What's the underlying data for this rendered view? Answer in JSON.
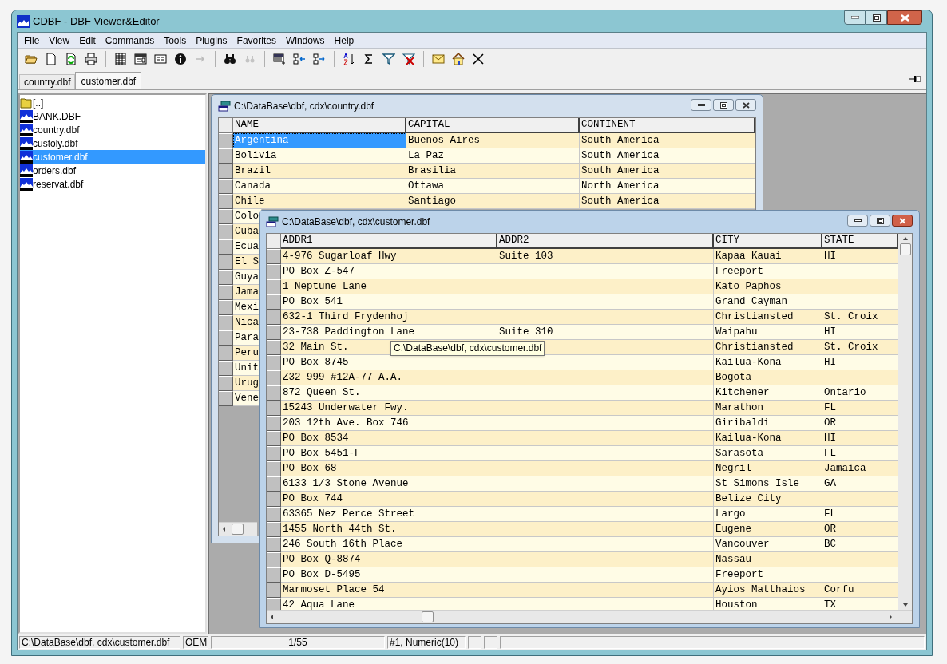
{
  "window": {
    "title": "CDBF - DBF Viewer&Editor"
  },
  "menu": [
    "File",
    "View",
    "Edit",
    "Commands",
    "Tools",
    "Plugins",
    "Favorites",
    "Windows",
    "Help"
  ],
  "toolbar": [
    {
      "disabled": false
    },
    {
      "disabled": false
    },
    {
      "disabled": false
    },
    {
      "disabled": false
    },
    {
      "disabled": false
    },
    {
      "disabled": false
    },
    {
      "disabled": false
    },
    {
      "disabled": false
    },
    {
      "disabled": true
    },
    {
      "disabled": false
    },
    {
      "disabled": true
    },
    {
      "disabled": false
    },
    {
      "disabled": false
    },
    {
      "disabled": false
    },
    {
      "disabled": false
    },
    {
      "disabled": false
    },
    {
      "disabled": false
    },
    {
      "disabled": false
    },
    {
      "disabled": false
    },
    {
      "disabled": false
    },
    {
      "disabled": false
    }
  ],
  "tabs": [
    {
      "label": "country.dbf",
      "selected": false
    },
    {
      "label": "customer.dbf",
      "selected": true
    }
  ],
  "files": [
    {
      "kind": "folder",
      "label": "[..]",
      "selected": false
    },
    {
      "kind": "dbf",
      "label": "BANK.DBF",
      "selected": false
    },
    {
      "kind": "dbf",
      "label": "country.dbf",
      "selected": false
    },
    {
      "kind": "dbf",
      "label": "custoly.dbf",
      "selected": false
    },
    {
      "kind": "dbf",
      "label": "customer.dbf",
      "selected": true
    },
    {
      "kind": "dbf",
      "label": "orders.dbf",
      "selected": false
    },
    {
      "kind": "dbf",
      "label": "reservat.dbf",
      "selected": false
    }
  ],
  "country_window": {
    "title": "C:\\DataBase\\dbf, cdx\\country.dbf",
    "active": false,
    "columns": [
      "NAME",
      "CAPITAL",
      "CONTINENT"
    ],
    "rows": [
      {
        "cells": [
          "Argentina",
          "Buenos Aires",
          "South America"
        ],
        "selected": true
      },
      {
        "cells": [
          "Bolivia",
          "La Paz",
          "South America"
        ],
        "selected": false
      },
      {
        "cells": [
          "Brazil",
          "Brasilia",
          "South America"
        ],
        "selected": false
      },
      {
        "cells": [
          "Canada",
          "Ottawa",
          "North America"
        ],
        "selected": false
      },
      {
        "cells": [
          "Chile",
          "Santiago",
          "South America"
        ],
        "selected": false
      },
      {
        "cells": [
          "Colo"
        ],
        "selected": false
      },
      {
        "cells": [
          "Cuba"
        ],
        "selected": false
      },
      {
        "cells": [
          "Ecua"
        ],
        "selected": false
      },
      {
        "cells": [
          "El S"
        ],
        "selected": false
      },
      {
        "cells": [
          "Guya"
        ],
        "selected": false
      },
      {
        "cells": [
          "Jama"
        ],
        "selected": false
      },
      {
        "cells": [
          "Mexi"
        ],
        "selected": false
      },
      {
        "cells": [
          "Nica"
        ],
        "selected": false
      },
      {
        "cells": [
          "Para"
        ],
        "selected": false
      },
      {
        "cells": [
          "Peru"
        ],
        "selected": false
      },
      {
        "cells": [
          "Unit"
        ],
        "selected": false
      },
      {
        "cells": [
          "Urug"
        ],
        "selected": false
      },
      {
        "cells": [
          "Vene"
        ],
        "selected": false
      }
    ]
  },
  "customer_window": {
    "title": "C:\\DataBase\\dbf, cdx\\customer.dbf",
    "active": true,
    "columns": [
      "ADDR1",
      "ADDR2",
      "CITY",
      "STATE"
    ],
    "rows": [
      [
        "4-976 Sugarloaf Hwy",
        "Suite 103",
        "Kapaa Kauai",
        "HI"
      ],
      [
        "PO Box Z-547",
        "",
        "Freeport",
        ""
      ],
      [
        "1 Neptune Lane",
        "",
        "Kato Paphos",
        ""
      ],
      [
        "PO Box 541",
        "",
        "Grand Cayman",
        ""
      ],
      [
        "632-1 Third Frydenhoj",
        "",
        "Christiansted",
        "St. Croix"
      ],
      [
        "23-738 Paddington Lane",
        "Suite 310",
        "Waipahu",
        "HI"
      ],
      [
        "32 Main St.",
        "",
        "Christiansted",
        "St. Croix"
      ],
      [
        "PO Box 8745",
        "",
        "Kailua-Kona",
        "HI"
      ],
      [
        "Z32 999 #12A-77 A.A.",
        "",
        "Bogota",
        ""
      ],
      [
        "872 Queen St.",
        "",
        "Kitchener",
        "Ontario"
      ],
      [
        "15243 Underwater Fwy.",
        "",
        "Marathon",
        "FL"
      ],
      [
        "203 12th Ave. Box 746",
        "",
        "Giribaldi",
        "OR"
      ],
      [
        "PO Box 8534",
        "",
        "Kailua-Kona",
        "HI"
      ],
      [
        "PO Box 5451-F",
        "",
        "Sarasota",
        "FL"
      ],
      [
        "PO Box 68",
        "",
        "Negril",
        "Jamaica"
      ],
      [
        "6133 1/3 Stone Avenue",
        "",
        "St Simons Isle",
        "GA"
      ],
      [
        "PO Box 744",
        "",
        "Belize City",
        ""
      ],
      [
        "63365 Nez Perce Street",
        "",
        "Largo",
        "FL"
      ],
      [
        "1455 North 44th St.",
        "",
        "Eugene",
        "OR"
      ],
      [
        "246 South 16th Place",
        "",
        "Vancouver",
        "BC"
      ],
      [
        "PO Box Q-8874",
        "",
        "Nassau",
        ""
      ],
      [
        "PO Box D-5495",
        "",
        "Freeport",
        ""
      ],
      [
        "Marmoset Place 54",
        "",
        "Ayios Matthaios",
        "Corfu"
      ],
      [
        "42 Aqua Lane",
        "",
        "Houston",
        "TX"
      ]
    ]
  },
  "tooltip": "C:\\DataBase\\dbf, cdx\\customer.dbf",
  "status_bar": [
    "C:\\DataBase\\dbf, cdx\\customer.dbf",
    "OEM",
    "1/55",
    "#1, Numeric(10)"
  ]
}
